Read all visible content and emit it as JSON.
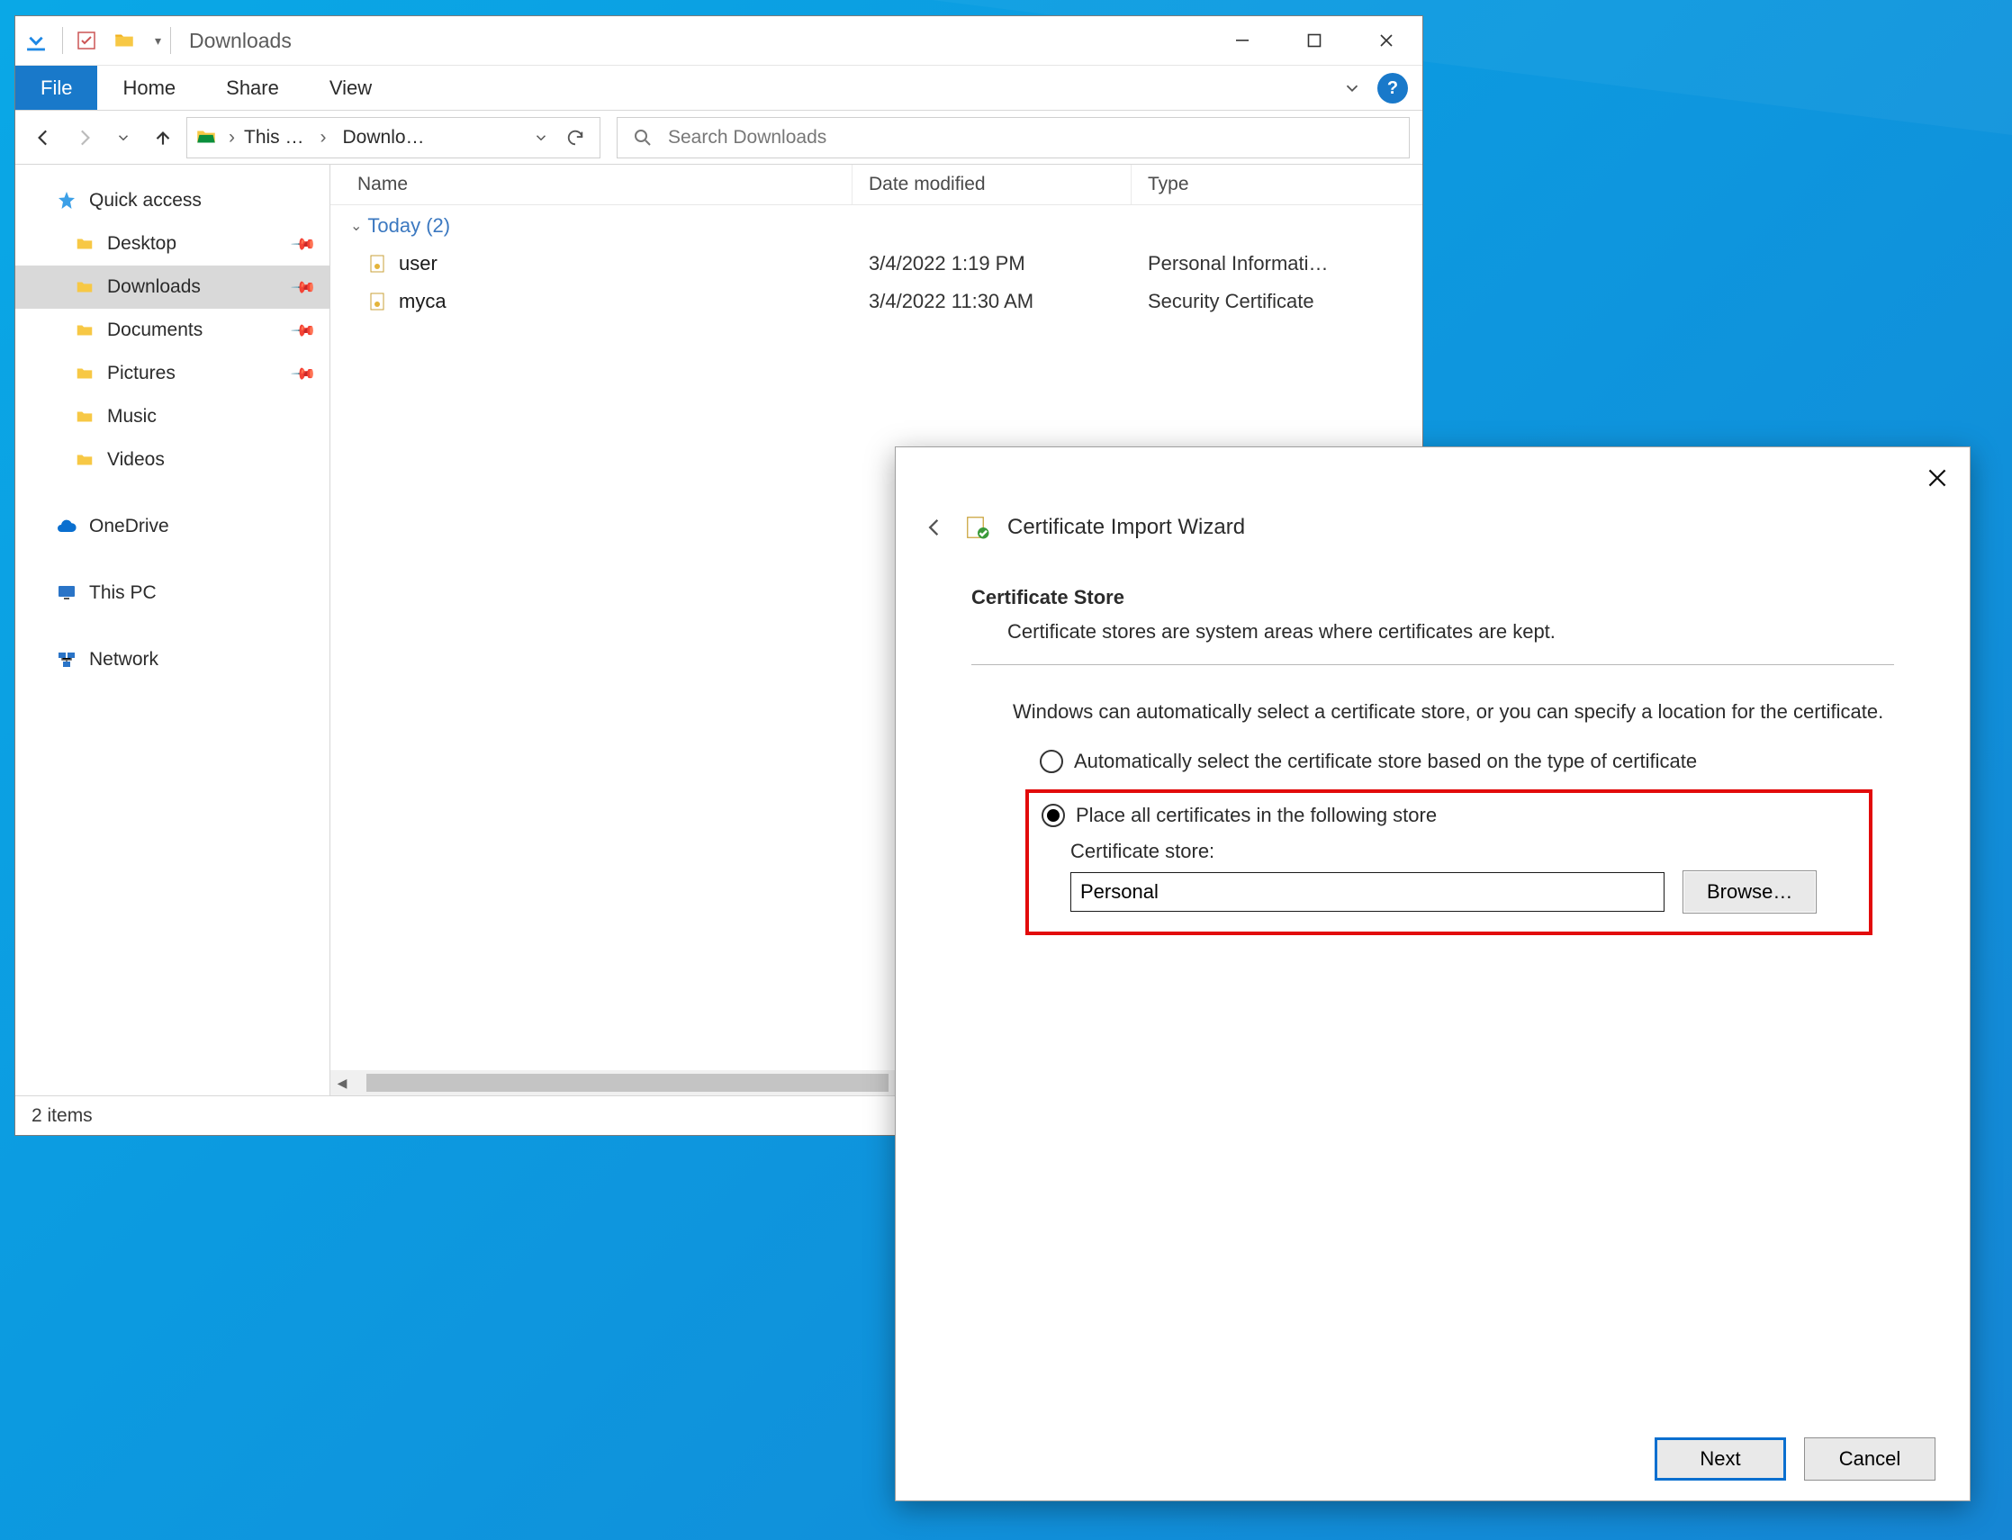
{
  "explorer": {
    "title": "Downloads",
    "ribbon": {
      "file": "File",
      "tabs": [
        "Home",
        "Share",
        "View"
      ]
    },
    "breadcrumb": {
      "part1": "This …",
      "part2": "Downlo…"
    },
    "search_placeholder": "Search Downloads",
    "columns": {
      "name": "Name",
      "date": "Date modified",
      "type": "Type"
    },
    "nav": {
      "quick_access": "Quick access",
      "items": [
        {
          "label": "Desktop"
        },
        {
          "label": "Downloads"
        },
        {
          "label": "Documents"
        },
        {
          "label": "Pictures"
        },
        {
          "label": "Music"
        },
        {
          "label": "Videos"
        }
      ],
      "onedrive": "OneDrive",
      "thispc": "This PC",
      "network": "Network"
    },
    "group_header": "Today (2)",
    "files": [
      {
        "name": "user",
        "date": "3/4/2022 1:19 PM",
        "type": "Personal Informati…"
      },
      {
        "name": "myca",
        "date": "3/4/2022 11:30 AM",
        "type": "Security Certificate"
      }
    ],
    "status": "2 items"
  },
  "wizard": {
    "title": "Certificate Import Wizard",
    "section_title": "Certificate Store",
    "section_desc": "Certificate stores are system areas where certificates are kept.",
    "paragraph": "Windows can automatically select a certificate store, or you can specify a location for the certificate.",
    "radio_auto": "Automatically select the certificate store based on the type of certificate",
    "radio_place": "Place all certificates in the following store",
    "store_label": "Certificate store:",
    "store_value": "Personal",
    "browse": "Browse…",
    "next": "Next",
    "cancel": "Cancel"
  }
}
